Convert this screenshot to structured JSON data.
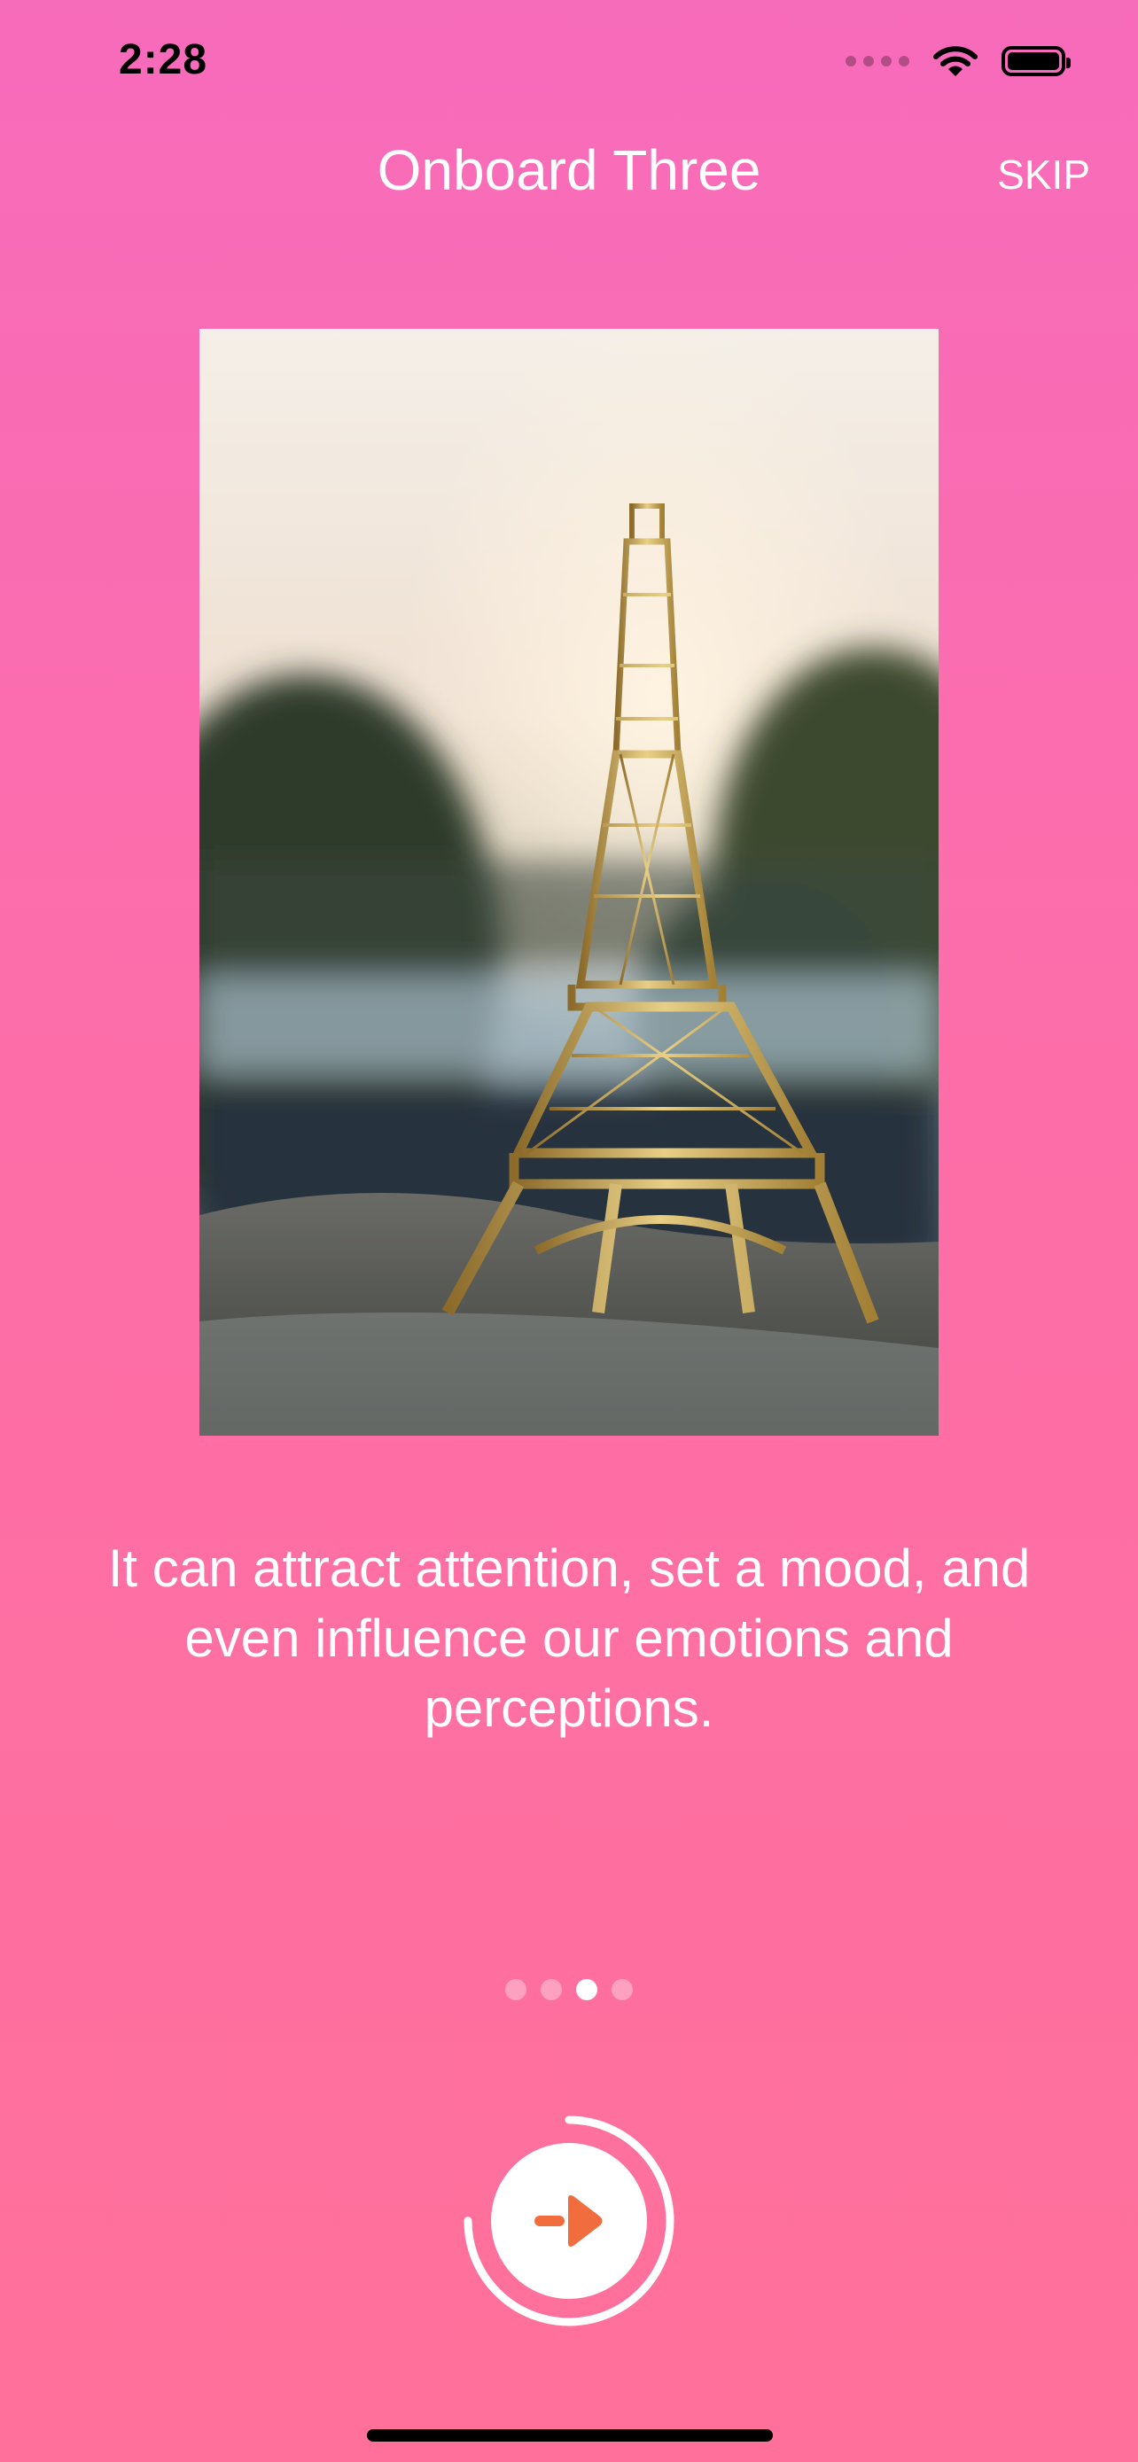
{
  "status_bar": {
    "time": "2:28",
    "icons": [
      "cellular-signal-icon",
      "wifi-icon",
      "battery-icon"
    ]
  },
  "header": {
    "title": "Onboard Three",
    "skip_label": "SKIP"
  },
  "photo": {
    "subject": "eiffel-tower-miniature"
  },
  "caption": "It can attract attention, set a mood, and even influence our emotions and perceptions.",
  "pagination": {
    "total": 4,
    "current": 3
  },
  "next_button": {
    "icon": "arrow-right-icon",
    "progress_fraction": 0.75
  },
  "colors": {
    "background_top": "#f76bbb",
    "background_bottom": "#ff709a",
    "accent": "#f26d3d",
    "text": "#ffffff"
  }
}
